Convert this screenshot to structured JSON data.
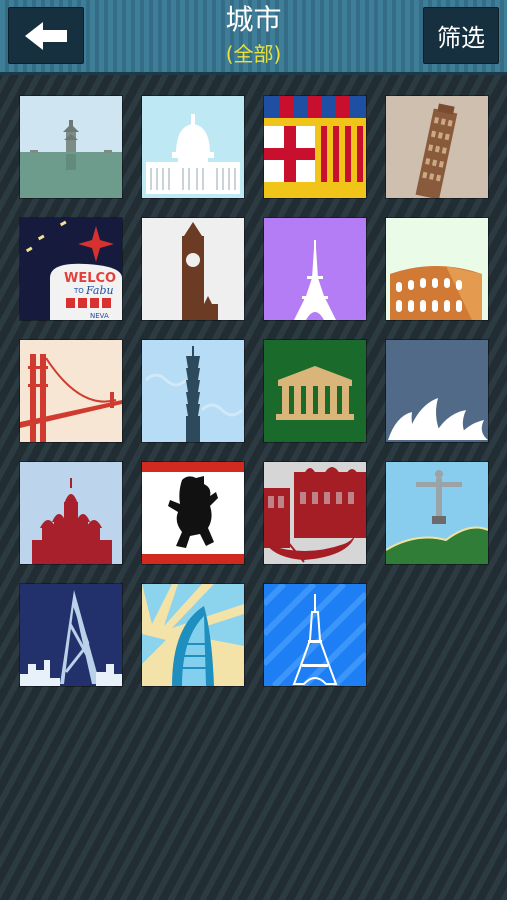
{
  "header": {
    "title": "城市",
    "subtitle": "(全部)",
    "filter_label": "筛选",
    "back_icon": "arrow-left-icon"
  },
  "cities": [
    {
      "icon": "hangzhou-pagoda-lake-icon"
    },
    {
      "icon": "washington-capitol-icon"
    },
    {
      "icon": "barcelona-flag-icon"
    },
    {
      "icon": "pisa-leaning-tower-icon"
    },
    {
      "icon": "las-vegas-sign-icon"
    },
    {
      "icon": "london-big-ben-icon"
    },
    {
      "icon": "paris-eiffel-tower-icon"
    },
    {
      "icon": "rome-colosseum-icon"
    },
    {
      "icon": "san-francisco-golden-gate-icon"
    },
    {
      "icon": "taipei-101-icon"
    },
    {
      "icon": "athens-parthenon-icon"
    },
    {
      "icon": "sydney-opera-house-icon"
    },
    {
      "icon": "moscow-st-basils-icon"
    },
    {
      "icon": "berlin-bear-icon"
    },
    {
      "icon": "venice-gondola-icon"
    },
    {
      "icon": "rio-christ-redeemer-icon"
    },
    {
      "icon": "hong-kong-bank-of-china-icon"
    },
    {
      "icon": "dubai-burj-al-arab-icon"
    },
    {
      "icon": "tokyo-tower-icon"
    }
  ],
  "las_vegas_sign": {
    "line1": "WELCO",
    "line2": "TO",
    "line3": "Fabu",
    "line4": "NEVA"
  }
}
